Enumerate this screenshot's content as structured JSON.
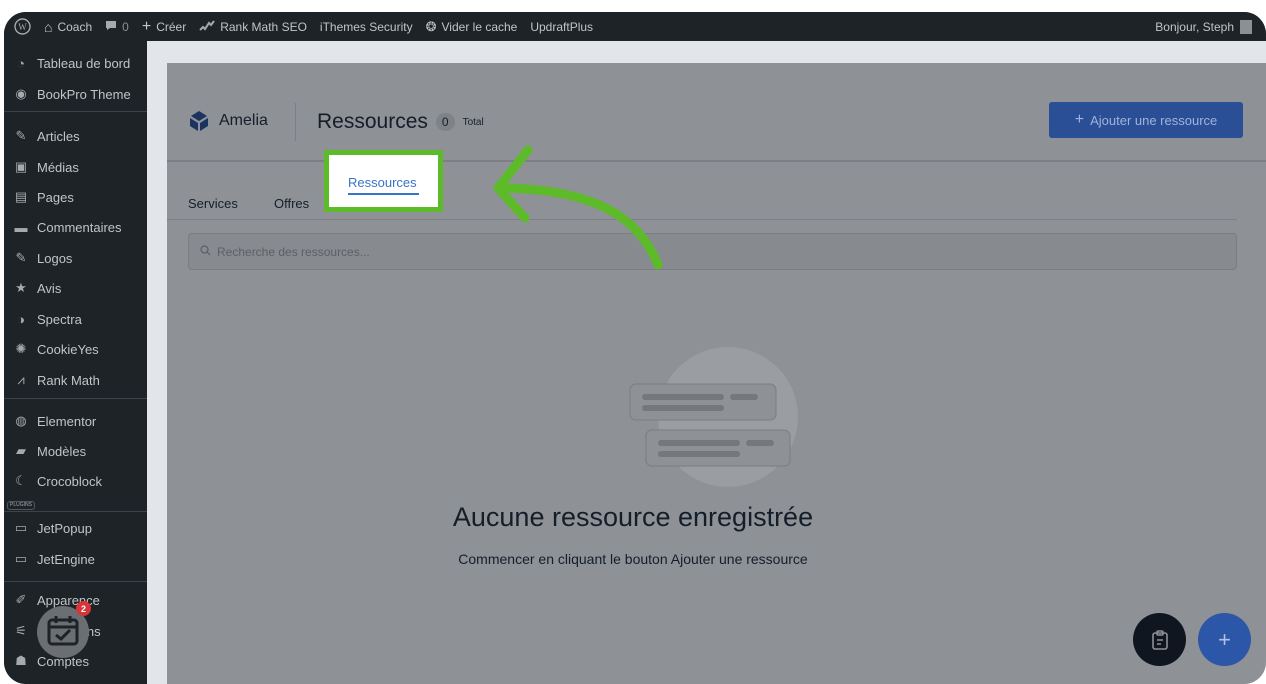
{
  "adminbar": {
    "site_name": "Coach",
    "comments_count": "0",
    "new_label": "Créer",
    "rankmath_label": "Rank Math SEO",
    "ithemes_label": "iThemes Security",
    "cache_label": "Vider le cache",
    "updraft_label": "UpdraftPlus",
    "greeting": "Bonjour, Steph"
  },
  "sidebar": {
    "items": [
      {
        "label": "Tableau de bord",
        "icon": "dashboard-icon"
      },
      {
        "label": "BookPro Theme",
        "icon": "theme-icon"
      },
      {
        "label": "Articles",
        "icon": "pin-icon"
      },
      {
        "label": "Médias",
        "icon": "media-icon"
      },
      {
        "label": "Pages",
        "icon": "page-icon"
      },
      {
        "label": "Commentaires",
        "icon": "comment-icon"
      },
      {
        "label": "Logos",
        "icon": "pin-icon"
      },
      {
        "label": "Avis",
        "icon": "star-icon"
      },
      {
        "label": "Spectra",
        "icon": "spectra-icon"
      },
      {
        "label": "CookieYes",
        "icon": "cookie-icon"
      },
      {
        "label": "Rank Math",
        "icon": "chart-icon"
      },
      {
        "label": "Elementor",
        "icon": "elementor-icon"
      },
      {
        "label": "Modèles",
        "icon": "folder-icon"
      },
      {
        "label": "Crocoblock",
        "icon": "crocoblock-icon"
      },
      {
        "label": "JetPopup",
        "icon": "jet-icon"
      },
      {
        "label": "JetEngine",
        "icon": "jet-icon"
      },
      {
        "label": "Apparence",
        "icon": "brush-icon"
      },
      {
        "label": "Extensions",
        "icon": "plugin-icon"
      },
      {
        "label": "Comptes",
        "icon": "user-icon"
      }
    ],
    "plugins_tag": "PLUGINS",
    "calendar_notification": "2"
  },
  "header": {
    "brand": "Amelia",
    "title": "Ressources",
    "count": "0",
    "count_label": "Total",
    "add_button": "Ajouter une ressource"
  },
  "tabs": {
    "services": "Services",
    "offers": "Offres",
    "resources": "Ressources"
  },
  "search": {
    "placeholder": "Recherche des ressources..."
  },
  "empty_state": {
    "title": "Aucune ressource enregistrée",
    "subtitle": "Commencer en cliquant le bouton Ajouter une ressource"
  },
  "colors": {
    "highlight": "#5dbb2a",
    "accent": "#3a74c6"
  }
}
